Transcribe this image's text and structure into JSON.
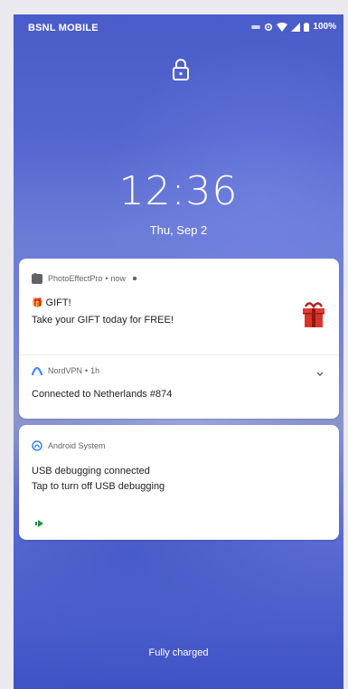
{
  "status_bar": {
    "carrier": "BSNL MOBILE",
    "battery": "100%"
  },
  "clock": {
    "time": "12:36",
    "date": "Thu, Sep 2"
  },
  "notifications": [
    {
      "app": "PhotoEffectPro",
      "time_separator": "•",
      "time": "now",
      "title_emoji": "🎁",
      "title": "GIFT!",
      "body": "Take your GIFT today for FREE!",
      "icon": "photo-app-icon"
    },
    {
      "app": "NordVPN",
      "time_separator": "•",
      "time": "1h",
      "body": "Connected to Netherlands #874",
      "icon": "nordvpn-icon"
    },
    {
      "app": "Android System",
      "title": "USB debugging connected",
      "body": "Tap to turn off USB debugging",
      "icon": "android-system-icon"
    }
  ],
  "footer": {
    "charging_status": "Fully charged"
  },
  "colors": {
    "nordvpn_blue": "#4687ff",
    "gift_red": "#d9342b",
    "action_green": "#1e8e3e"
  }
}
